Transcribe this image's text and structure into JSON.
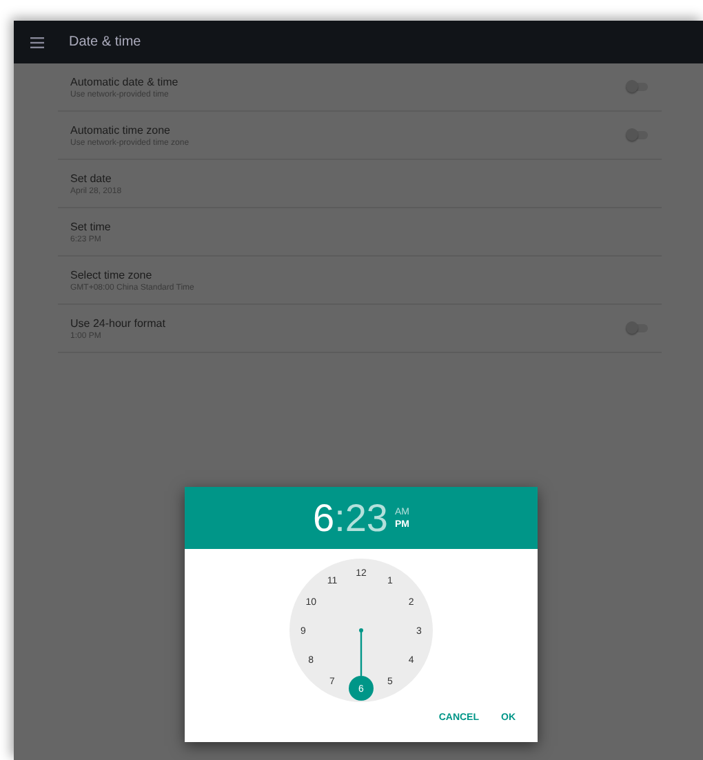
{
  "app_bar": {
    "title": "Date & time"
  },
  "settings": [
    {
      "title": "Automatic date & time",
      "summary": "Use network-provided time",
      "kind": "switch",
      "on": false
    },
    {
      "title": "Automatic time zone",
      "summary": "Use network-provided time zone",
      "kind": "switch",
      "on": false
    },
    {
      "title": "Set date",
      "summary": "April 28, 2018",
      "kind": "plain"
    },
    {
      "title": "Set time",
      "summary": "6:23 PM",
      "kind": "plain"
    },
    {
      "title": "Select time zone",
      "summary": "GMT+08:00 China Standard Time",
      "kind": "plain"
    },
    {
      "title": "Use 24-hour format",
      "summary": "1:00 PM",
      "kind": "switch",
      "on": false
    }
  ],
  "time_dialog": {
    "hour": "6",
    "separator": ":",
    "minute": "23",
    "periods": [
      {
        "label": "AM",
        "selected": false
      },
      {
        "label": "PM",
        "selected": true
      }
    ],
    "clock": [
      {
        "label": "12",
        "selected": false
      },
      {
        "label": "1",
        "selected": false
      },
      {
        "label": "2",
        "selected": false
      },
      {
        "label": "3",
        "selected": false
      },
      {
        "label": "4",
        "selected": false
      },
      {
        "label": "5",
        "selected": false
      },
      {
        "label": "6",
        "selected": true
      },
      {
        "label": "7",
        "selected": false
      },
      {
        "label": "8",
        "selected": false
      },
      {
        "label": "9",
        "selected": false
      },
      {
        "label": "10",
        "selected": false
      },
      {
        "label": "11",
        "selected": false
      }
    ],
    "buttons": [
      "CANCEL",
      "OK"
    ]
  }
}
